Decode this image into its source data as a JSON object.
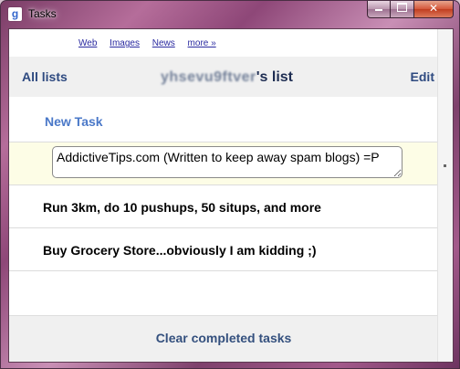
{
  "window": {
    "title": "Tasks",
    "app_icon": "google-g-icon",
    "controls": {
      "minimize": "minimize-icon",
      "maximize": "maximize-icon",
      "close": "close-icon"
    }
  },
  "topnav": {
    "web": "Web",
    "images": "Images",
    "news": "News",
    "more": "more »"
  },
  "header": {
    "all_lists": "All lists",
    "owner_obscured": "yhsevu9ftver",
    "list_suffix": "'s list",
    "edit": "Edit"
  },
  "new_task": "New Task",
  "tasks": [
    {
      "text": "AddictiveTips.com (Written to keep away spam blogs) =P",
      "editing": true
    },
    {
      "text": "Run 3km, do 10 pushups, 50 situps, and more"
    },
    {
      "text": "Buy Grocery Store...obviously I am kidding ;)"
    },
    {
      "text": ""
    }
  ],
  "footer": {
    "clear_completed": "Clear completed tasks"
  },
  "colors": {
    "link": "#2a2aa0",
    "header_text": "#2e4a80",
    "new_task": "#4a78c8",
    "active_row_bg": "#fdfde6",
    "panel_bg": "#f0f0f0"
  }
}
